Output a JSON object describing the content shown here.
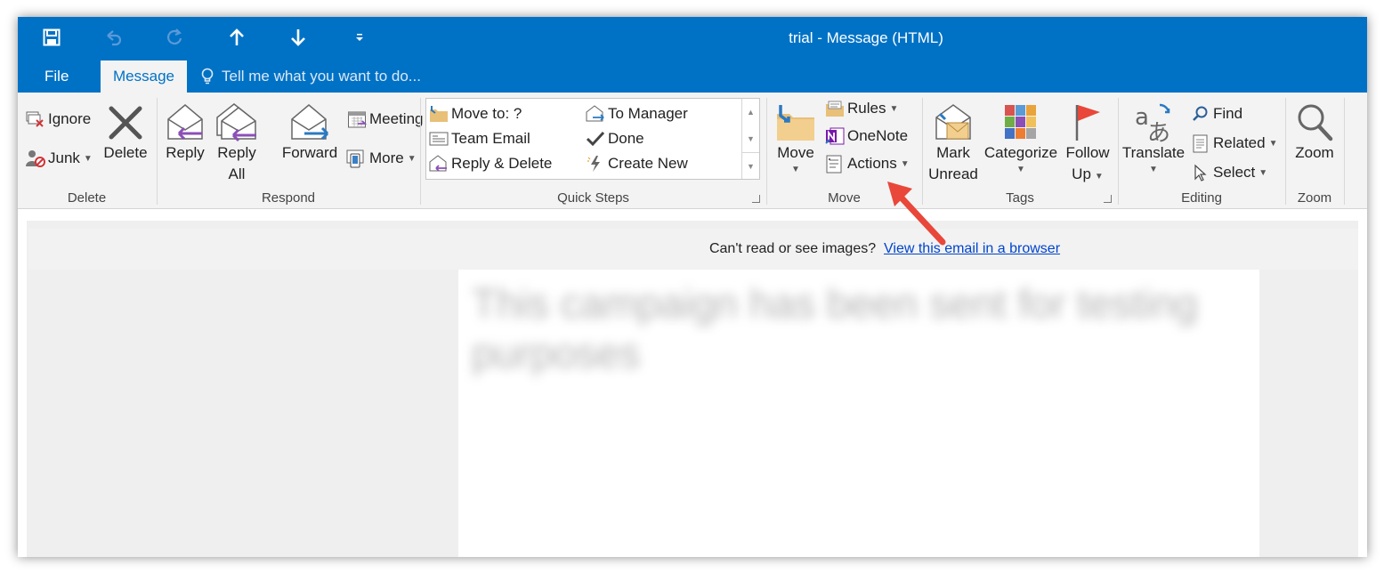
{
  "window": {
    "title": "trial - Message (HTML)"
  },
  "quick_access": {
    "save_icon": "save-icon",
    "undo_icon": "undo-icon",
    "redo_icon": "redo-icon",
    "previous_icon": "up-arrow-icon",
    "next_icon": "down-arrow-icon",
    "customize_icon": "chevron-down-icon"
  },
  "tabs": {
    "file": "File",
    "message": "Message",
    "tell_me": "Tell me what you want to do..."
  },
  "ribbon": {
    "delete_group": {
      "label": "Delete",
      "ignore": "Ignore",
      "junk": "Junk",
      "delete": "Delete"
    },
    "respond_group": {
      "label": "Respond",
      "reply": "Reply",
      "reply_all_line1": "Reply",
      "reply_all_line2": "All",
      "forward": "Forward",
      "meeting": "Meeting",
      "more": "More"
    },
    "quick_steps_group": {
      "label": "Quick Steps",
      "items": [
        "Move to: ?",
        "Team Email",
        "Reply & Delete",
        "To Manager",
        "Done",
        "Create New"
      ]
    },
    "move_group": {
      "label": "Move",
      "move": "Move",
      "rules": "Rules",
      "onenote": "OneNote",
      "actions": "Actions"
    },
    "tags_group": {
      "label": "Tags",
      "mark_unread_line1": "Mark",
      "mark_unread_line2": "Unread",
      "categorize": "Categorize",
      "follow_up_line1": "Follow",
      "follow_up_line2": "Up"
    },
    "editing_group": {
      "label": "Editing",
      "translate": "Translate",
      "find": "Find",
      "related": "Related",
      "select": "Select"
    },
    "zoom_group": {
      "label": "Zoom",
      "zoom": "Zoom"
    }
  },
  "email": {
    "images_notice": "Can't read or see images?",
    "browser_link": "View this email in a browser",
    "body_blurred": "This campaign has been sent for testing purposes"
  },
  "colors": {
    "title_bar": "#0072c6",
    "ribbon_bg": "#f3f3f3",
    "link": "#0044cc",
    "annotation_arrow": "#e8473a"
  }
}
